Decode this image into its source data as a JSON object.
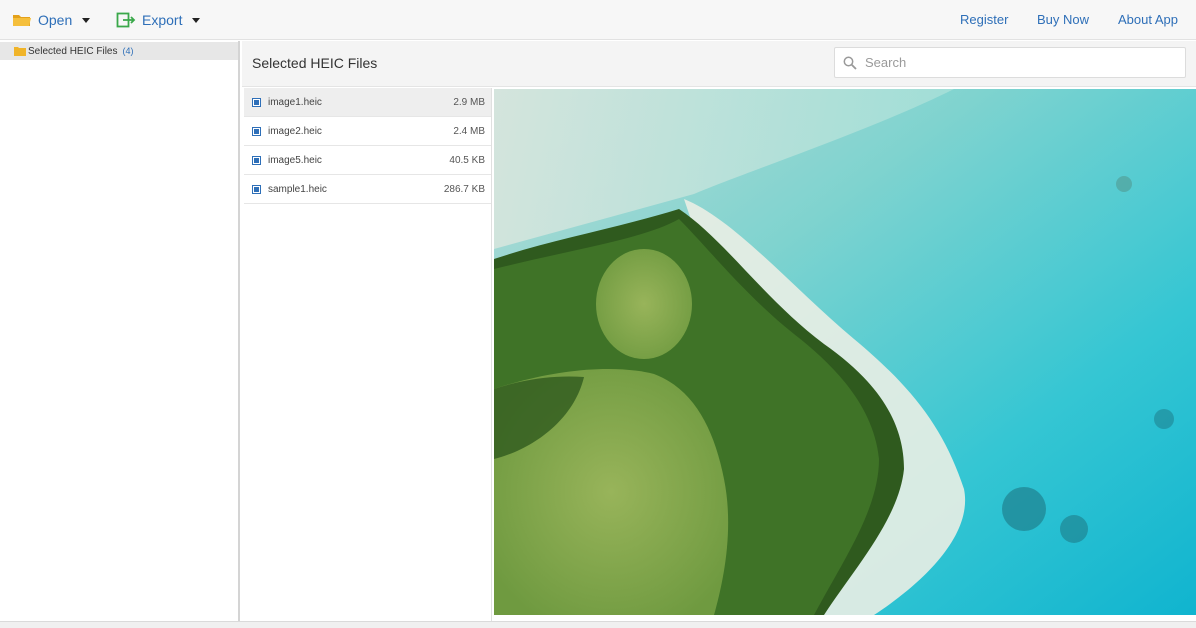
{
  "toolbar": {
    "open_label": "Open",
    "export_label": "Export",
    "register_label": "Register",
    "buy_label": "Buy Now",
    "about_label": "About App"
  },
  "sidebar": {
    "items": [
      {
        "label": "Selected HEIC Files",
        "count": "(4)"
      }
    ]
  },
  "main": {
    "title": "Selected HEIC Files",
    "search_placeholder": "Search"
  },
  "files": [
    {
      "name": "image1.heic",
      "size": "2.9 MB"
    },
    {
      "name": "image2.heic",
      "size": "2.4 MB"
    },
    {
      "name": "image5.heic",
      "size": "40.5 KB"
    },
    {
      "name": "sample1.heic",
      "size": "286.7 KB"
    }
  ],
  "colors": {
    "accent": "#2e6fb8",
    "folder": "#f0b429",
    "export_icon": "#3aa84a"
  },
  "preview": {
    "icon": "aerial-island-photo"
  }
}
